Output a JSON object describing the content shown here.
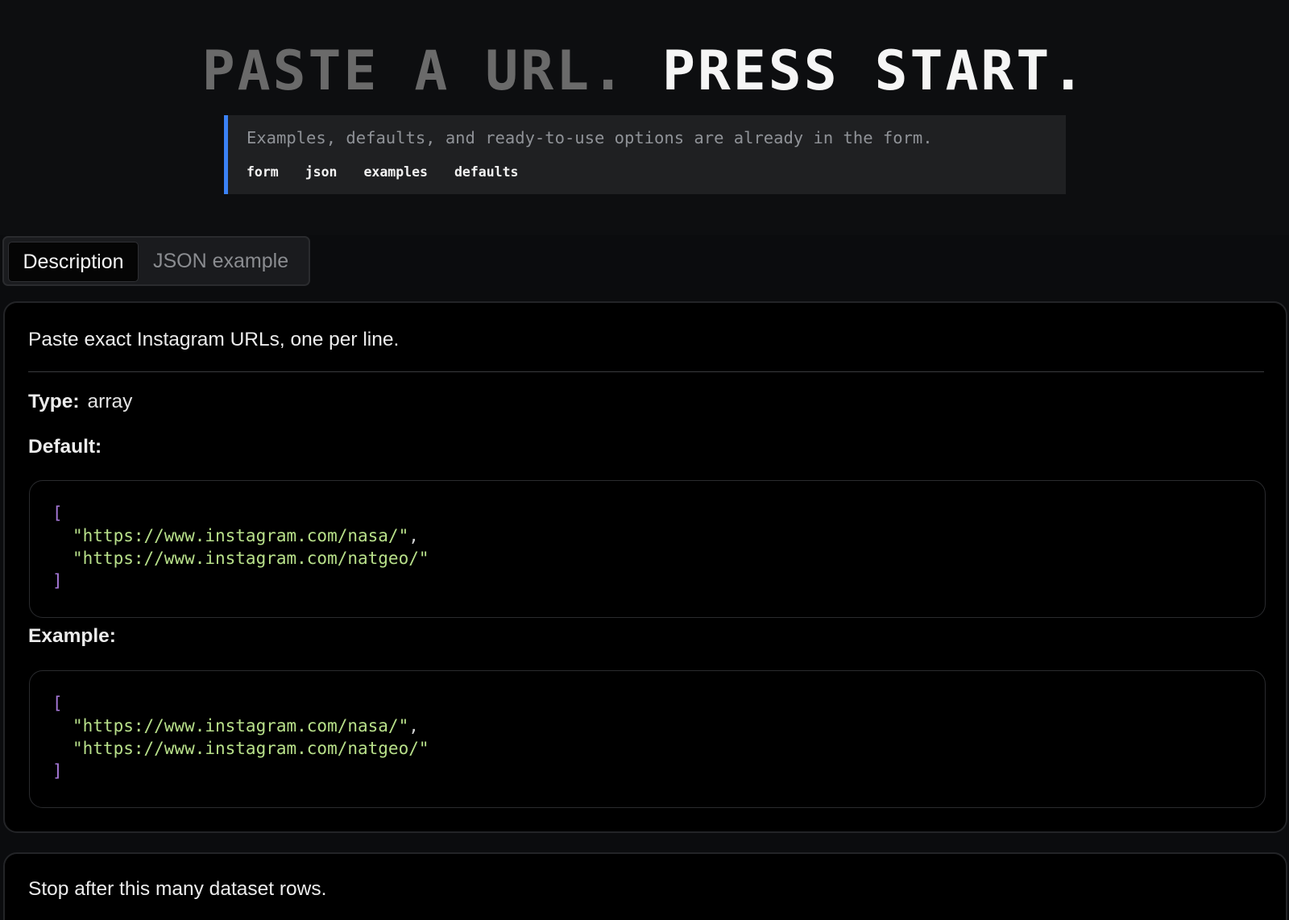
{
  "hero": {
    "title_dim": "PASTE A URL.",
    "title_bright": "PRESS START.",
    "callout_text": "Examples, defaults, and ready-to-use options are already in the form.",
    "tags": [
      "form",
      "json",
      "examples",
      "defaults"
    ]
  },
  "tabs": {
    "active_label": "Description",
    "inactive_label": "JSON example"
  },
  "field": {
    "lead": "Paste exact Instagram URLs, one per line.",
    "type_label": "Type:",
    "type_value": "array",
    "default_label": "Default:",
    "example_label": "Example:",
    "default_code": {
      "open": "[",
      "items": [
        "\"https://www.instagram.com/nasa/\"",
        "\"https://www.instagram.com/natgeo/\""
      ],
      "comma": ",",
      "close": "]"
    },
    "example_code": {
      "open": "[",
      "items": [
        "\"https://www.instagram.com/nasa/\"",
        "\"https://www.instagram.com/natgeo/\""
      ],
      "comma": ",",
      "close": "]"
    }
  },
  "next_field": {
    "lead": "Stop after this many dataset rows."
  },
  "colors": {
    "accent": "#3b82f6",
    "code_bracket": "#a678d8",
    "code_string": "#b8e08a"
  }
}
